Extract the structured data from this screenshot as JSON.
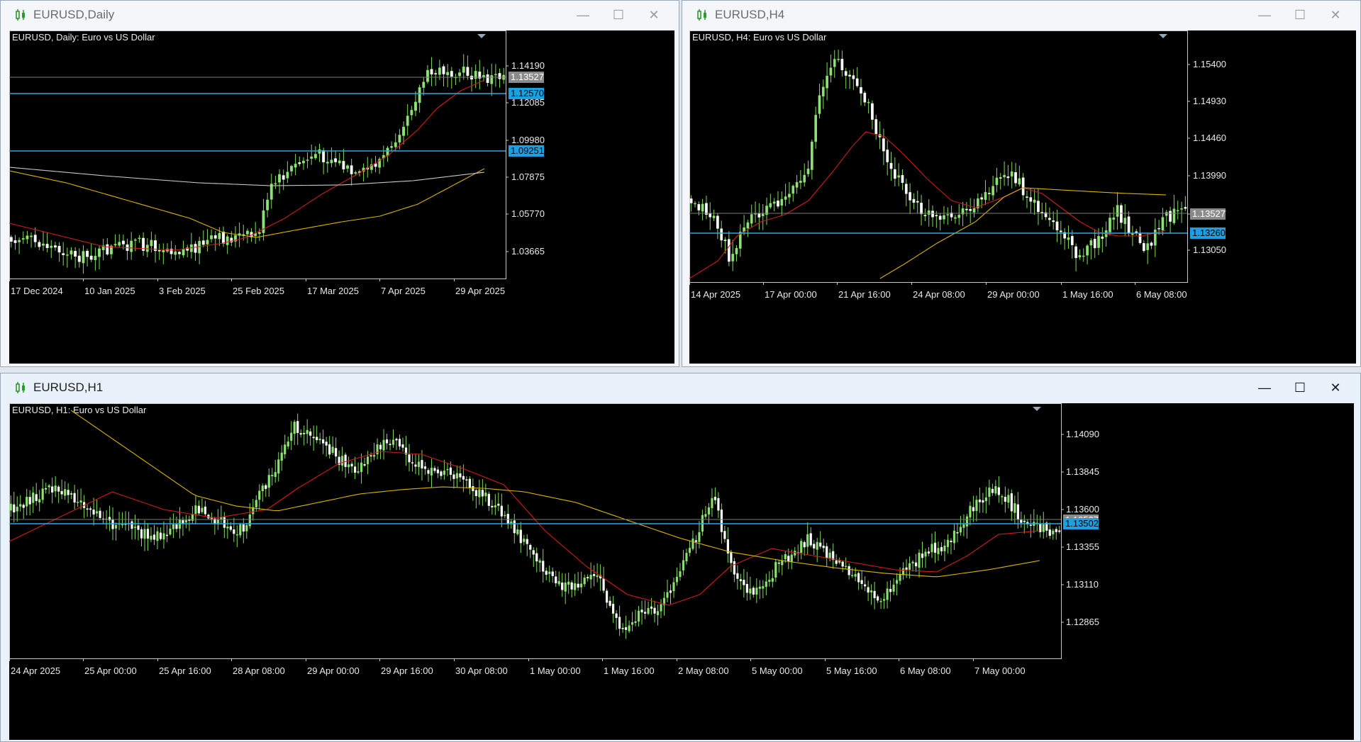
{
  "colors": {
    "bull": "#8fe07a",
    "bear": "#ffffff",
    "wick": "#7fdc5c",
    "ma_fast": "#d11a1a",
    "ma_slow": "#d8b400",
    "ma_long": "#c8c8c8",
    "hline": "#2ea8e0",
    "price_tag": "#8a8a8a",
    "level_tag": "#1ba0e2"
  },
  "windows": [
    {
      "id": "daily",
      "title": "EURUSD,Daily",
      "active": false,
      "header": "EURUSD, Daily:  Euro vs US Dollar",
      "price_levels": [
        "1.14190",
        "1.12085",
        "1.09980",
        "1.07875",
        "1.05770",
        "1.03665"
      ],
      "time_labels": [
        "17 Dec 2024",
        "10 Jan 2025",
        "3 Feb 2025",
        "25 Feb 2025",
        "17 Mar 2025",
        "7 Apr 2025",
        "29 Apr 2025"
      ],
      "current_price": "1.13527",
      "levels": [
        "1.12570",
        "1.09251"
      ]
    },
    {
      "id": "h4",
      "title": "EURUSD,H4",
      "active": false,
      "header": "EURUSD, H4:  Euro vs US Dollar",
      "price_levels": [
        "1.15400",
        "1.14930",
        "1.14460",
        "1.13990",
        "1.13527",
        "1.13050"
      ],
      "time_labels": [
        "14 Apr 2025",
        "17 Apr 00:00",
        "21 Apr 16:00",
        "24 Apr 08:00",
        "29 Apr 00:00",
        "1 May 16:00",
        "6 May 08:00"
      ],
      "current_price": "1.13527",
      "levels": [
        "1.13260"
      ]
    },
    {
      "id": "h1",
      "title": "EURUSD,H1",
      "active": true,
      "header": "EURUSD, H1:  Euro vs US Dollar",
      "price_levels": [
        "1.14090",
        "1.13845",
        "1.13600",
        "1.13355",
        "1.13110",
        "1.12865"
      ],
      "time_labels": [
        "24 Apr 2025",
        "25 Apr 00:00",
        "25 Apr 16:00",
        "28 Apr 08:00",
        "29 Apr 00:00",
        "29 Apr 16:00",
        "30 Apr 08:00",
        "1 May 00:00",
        "1 May 16:00",
        "2 May 08:00",
        "5 May 00:00",
        "5 May 16:00",
        "6 May 08:00",
        "7 May 00:00"
      ],
      "current_price": "1.13527",
      "levels": [
        "1.13502"
      ]
    }
  ]
}
